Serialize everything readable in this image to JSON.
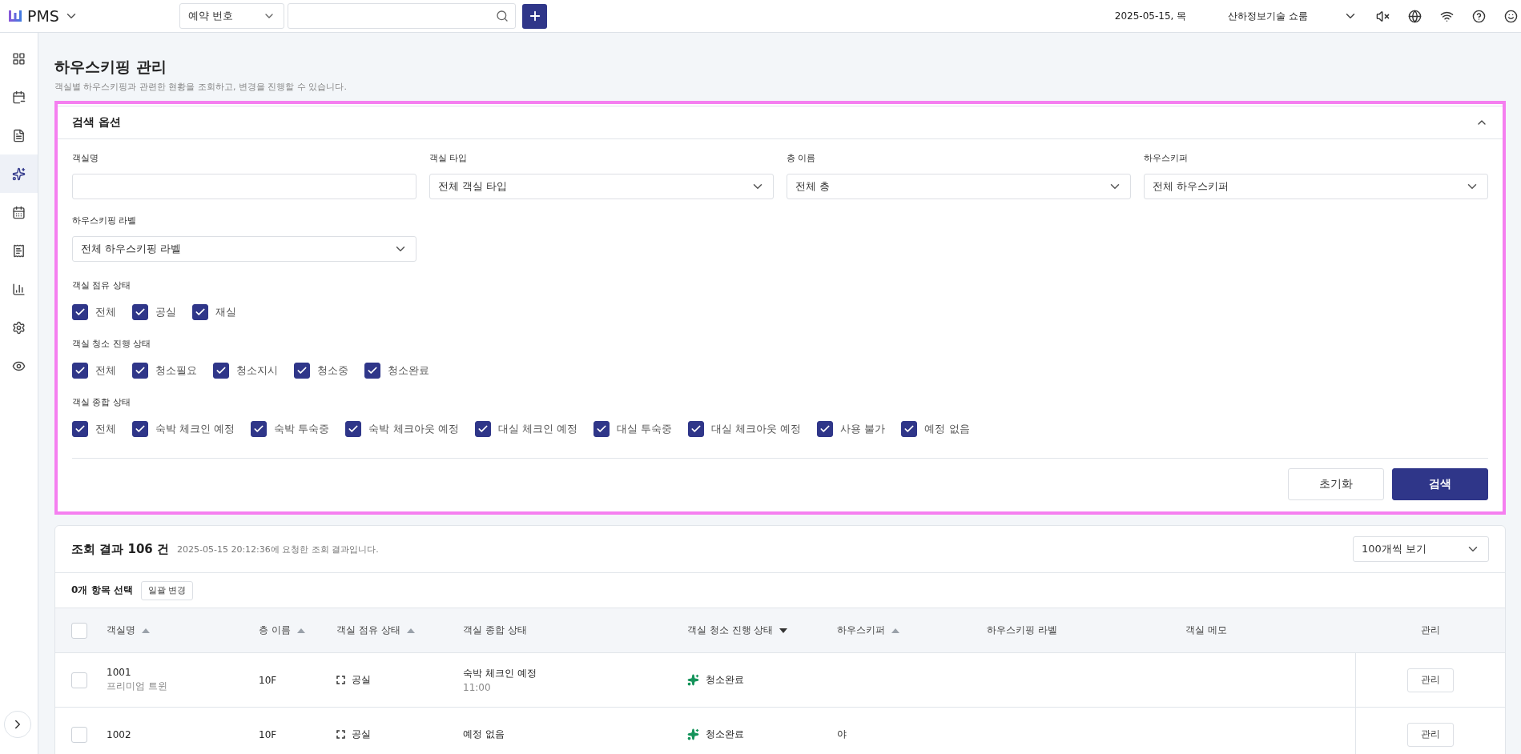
{
  "topbar": {
    "brand": "PMS",
    "search_type": "예약 번호",
    "date": "2025-05-15, 목",
    "property": "산하정보기술 쇼룸"
  },
  "sidebar": {
    "items": [
      {
        "selected": false
      },
      {
        "selected": false
      },
      {
        "selected": false
      },
      {
        "selected": true
      },
      {
        "selected": false
      },
      {
        "selected": false
      },
      {
        "selected": false
      },
      {
        "selected": false
      },
      {
        "selected": false
      }
    ]
  },
  "page": {
    "title": "하우스키핑 관리",
    "subtitle": "객실별 하우스키핑과 관련한 현황을 조회하고, 변경을 진행할 수 있습니다."
  },
  "search_options": {
    "title": "검색 옵션",
    "expanded": true,
    "highlighted": true,
    "fields": [
      {
        "label": "객실명",
        "kind": "text"
      },
      {
        "label": "객실 타입",
        "kind": "select",
        "value": "전체 객실 타입"
      },
      {
        "label": "층 이름",
        "kind": "select",
        "value": "전체 층"
      },
      {
        "label": "하우스키퍼",
        "kind": "select",
        "value": "전체 하우스키퍼"
      },
      {
        "label": "하우스키핑 라벨",
        "kind": "select",
        "value": "전체 하우스키핑 라벨"
      }
    ],
    "checkbox_groups": [
      {
        "label": "객실 점유 상태",
        "options": [
          {
            "label": "전체",
            "checked": true
          },
          {
            "label": "공실",
            "checked": true
          },
          {
            "label": "재실",
            "checked": true
          }
        ]
      },
      {
        "label": "객실 청소 진행 상태",
        "options": [
          {
            "label": "전체",
            "checked": true
          },
          {
            "label": "청소필요",
            "checked": true
          },
          {
            "label": "청소지시",
            "checked": true
          },
          {
            "label": "청소중",
            "checked": true
          },
          {
            "label": "청소완료",
            "checked": true
          }
        ]
      },
      {
        "label": "객실 종합 상태",
        "options": [
          {
            "label": "전체",
            "checked": true
          },
          {
            "label": "숙박 체크인 예정",
            "checked": true
          },
          {
            "label": "숙박 투숙중",
            "checked": true
          },
          {
            "label": "숙박 체크아웃 예정",
            "checked": true
          },
          {
            "label": "대실 체크인 예정",
            "checked": true
          },
          {
            "label": "대실 투숙중",
            "checked": true
          },
          {
            "label": "대실 체크아웃 예정",
            "checked": true
          },
          {
            "label": "사용 불가",
            "checked": true
          },
          {
            "label": "예정 없음",
            "checked": true
          }
        ]
      }
    ],
    "buttons": [
      {
        "label": "초기화",
        "kind": "secondary"
      },
      {
        "label": "검색",
        "kind": "primary"
      }
    ]
  },
  "results": {
    "title": "조회 결과 106 건",
    "note": "2025-05-15 20:12:36에 요청한 조회 결과입니다.",
    "page_size": "100개씩 보기",
    "selection": "0개 항목 선택",
    "bulk_button": "일괄 변경",
    "select_all": false,
    "columns": [
      {
        "label": "객실명",
        "sortable": true,
        "descending": false
      },
      {
        "label": "층 이름",
        "sortable": true,
        "descending": false
      },
      {
        "label": "객실 점유 상태",
        "sortable": true,
        "descending": false
      },
      {
        "label": "객실 종합 상태",
        "sortable": false
      },
      {
        "label": "객실 청소 진행 상태",
        "sortable": true,
        "descending": true
      },
      {
        "label": "하우스키퍼",
        "sortable": true,
        "descending": false
      },
      {
        "label": "하우스키핑 라벨",
        "sortable": false
      },
      {
        "label": "객실 메모",
        "sortable": false
      },
      {
        "label": "관리",
        "sortable": false
      }
    ],
    "rows": [
      {
        "checked": false,
        "room": "1001",
        "room_type": "프리미엄 트윈",
        "floor": "10F",
        "occupancy": "공실",
        "status": "숙박 체크인 예정",
        "status_time": "11:00",
        "cleaning": "청소완료",
        "action": "관리"
      },
      {
        "checked": false,
        "room": "1002",
        "floor": "10F",
        "occupancy": "공실",
        "status": "예정 없음",
        "cleaning": "청소완료",
        "housekeeper": "야",
        "action": "관리"
      }
    ]
  }
}
